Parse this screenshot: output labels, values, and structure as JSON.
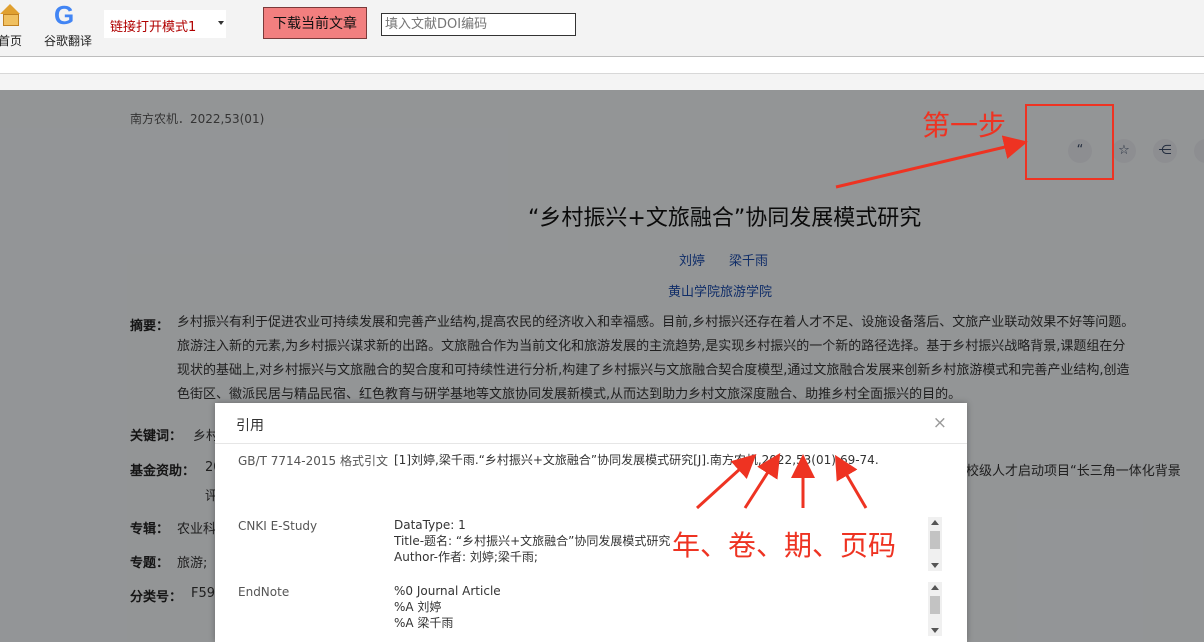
{
  "toolbar": {
    "home_label": "首页",
    "translate_label": "谷歌翻译",
    "translate_icon": "G",
    "mode_select_value": "链接打开模式1",
    "download_label": "下载当前文章",
    "doi_placeholder": "填入文献DOI编码"
  },
  "article": {
    "journal": "南方农机．2022,53(01)",
    "title": "“乡村振兴+文旅融合”协同发展模式研究",
    "authors": [
      "刘婷",
      "梁千雨"
    ],
    "affiliation": "黄山学院旅游学院",
    "abstract_label": "摘要：",
    "abstract_lines": [
      "乡村振兴有利于促进农业可持续发展和完善产业结构,提高农民的经济收入和幸福感。目前,乡村振兴还存在着人才不足、设施设备落后、文旅产业联动效果不好等问题。",
      "旅游注入新的元素,为乡村振兴谋求新的出路。文旅融合作为当前文化和旅游发展的主流趋势,是实现乡村振兴的一个新的路径选择。基于乡村振兴战略背景,课题组在分",
      "现状的基础上,对乡村振兴与文旅融合的契合度和可持续性进行分析,构建了乡村振兴与文旅融合契合度模型,通过文旅融合发展来创新乡村旅游模式和完善产业结构,创造",
      "色街区、徽派民居与精品民宿、红色教育与研学基地等文旅协同发展新模式,从而达到助力乡村文旅深度融合、助推乡村全面振兴的目的。"
    ],
    "keywords_label": "关键词：",
    "keywords_value": "乡村",
    "fund_label": "基金资助：",
    "fund_value": "20",
    "fund_value2": "评",
    "fund_right": "校级人才启动项目“长三角一体化背景",
    "special_label": "专辑：",
    "special_value": "农业科",
    "topic_label": "专题：",
    "topic_value": "旅游;",
    "class_label": "分类号：",
    "class_value": "F59"
  },
  "actions": {
    "cite_icon": "quote-icon",
    "fav_icon": "star-icon",
    "share_icon": "share-icon",
    "cite_glyph": "“",
    "fav_glyph": "☆",
    "share_glyph": "⋲"
  },
  "modal": {
    "title": "引用",
    "close_glyph": "×",
    "gb_label": "GB/T 7714-2015 格式引文",
    "gb_text": "[1]刘婷,梁千雨.“乡村振兴+文旅融合”协同发展模式研究[J].南方农机,2022,53(01):69-74.",
    "estudy_label": "CNKI E-Study",
    "estudy_lines": [
      "DataType: 1",
      "Title-题名: “乡村振兴+文旅融合”协同发展模式研究",
      "Author-作者: 刘婷;梁千雨;"
    ],
    "endnote_label": "EndNote",
    "endnote_lines": [
      "%0 Journal Article",
      "%A 刘婷",
      "%A 梁千雨"
    ]
  },
  "annotations": {
    "step_one": "第一步",
    "fields": "年、卷、期、页码",
    "color": "#ee3322"
  }
}
